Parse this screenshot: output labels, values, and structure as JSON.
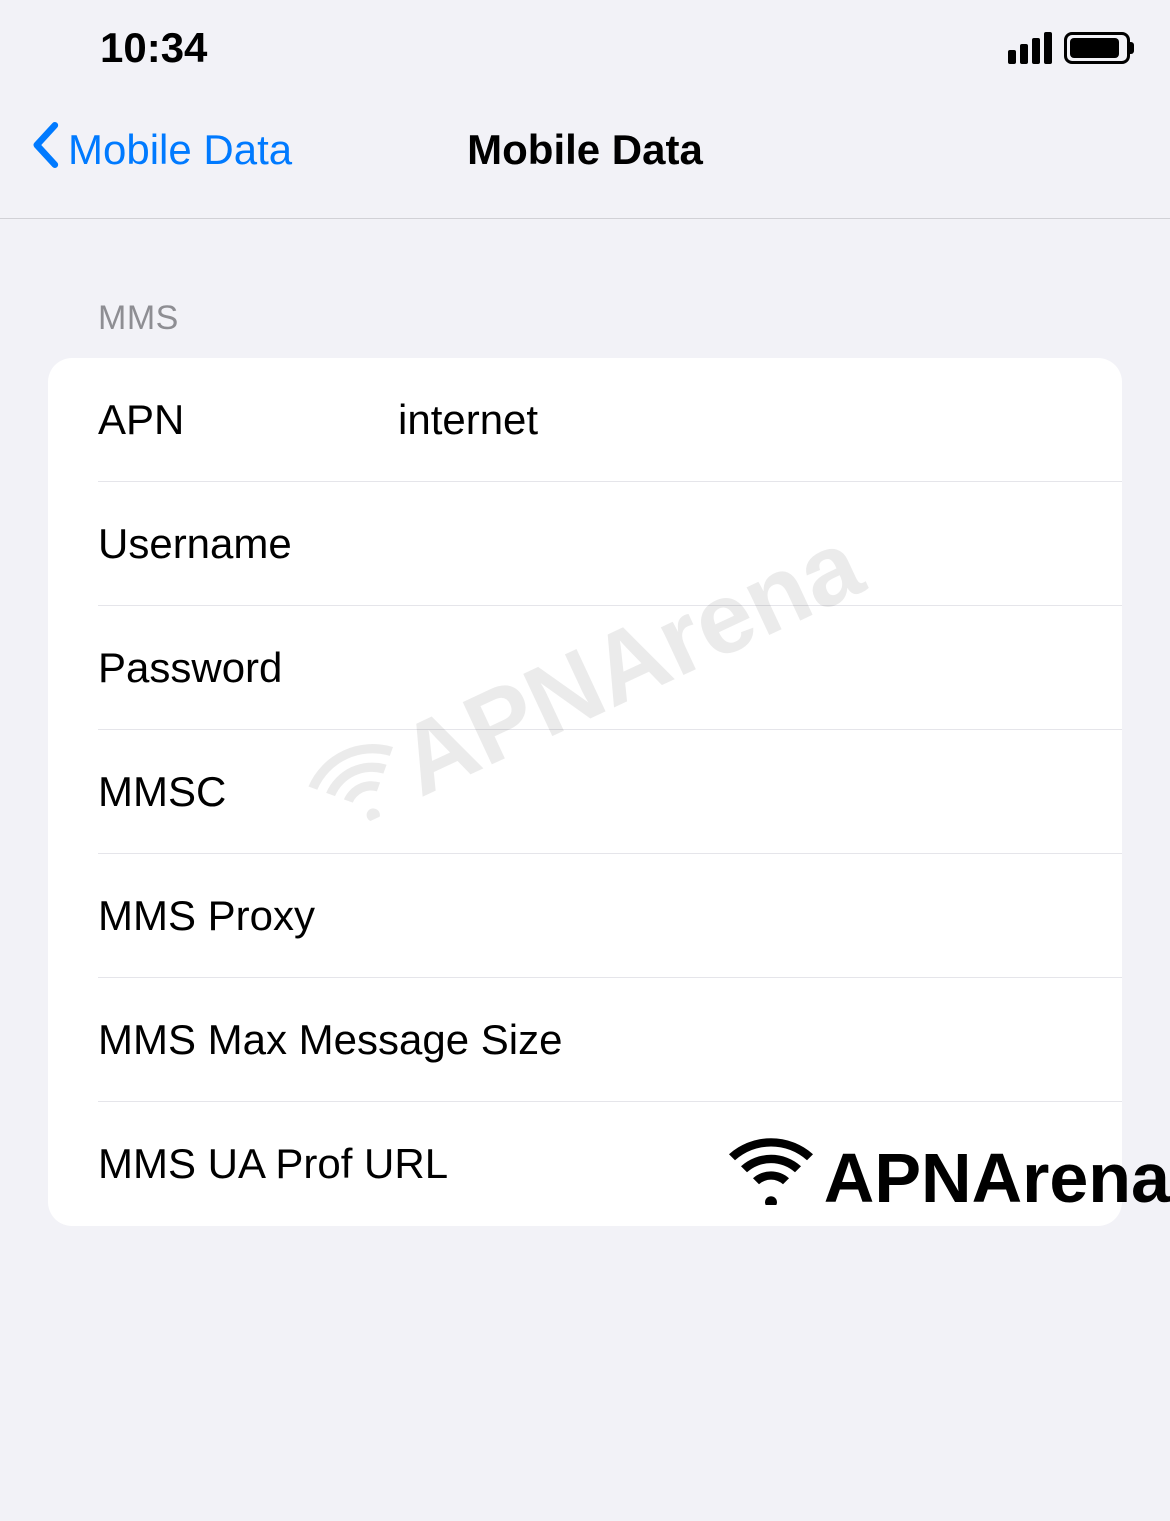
{
  "statusbar": {
    "time": "10:34"
  },
  "nav": {
    "back_label": "Mobile Data",
    "title": "Mobile Data"
  },
  "section": {
    "header": "MMS"
  },
  "fields": {
    "apn": {
      "label": "APN",
      "value": "internet"
    },
    "username": {
      "label": "Username",
      "value": ""
    },
    "password": {
      "label": "Password",
      "value": ""
    },
    "mmsc": {
      "label": "MMSC",
      "value": ""
    },
    "mms_proxy": {
      "label": "MMS Proxy",
      "value": ""
    },
    "mms_max_size": {
      "label": "MMS Max Message Size",
      "value": ""
    },
    "mms_ua_prof": {
      "label": "MMS UA Prof URL",
      "value": ""
    }
  },
  "watermark": {
    "text": "APNArena"
  }
}
